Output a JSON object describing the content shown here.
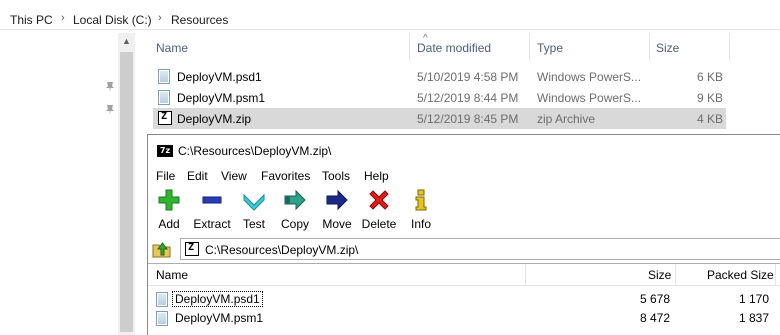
{
  "explorer": {
    "breadcrumb": [
      "This PC",
      "Local Disk (C:)",
      "Resources"
    ],
    "columns": {
      "name": "Name",
      "date": "Date modified",
      "type": "Type",
      "size": "Size"
    },
    "files": [
      {
        "name": "DeployVM.psd1",
        "date": "5/10/2019 4:58 PM",
        "type": "Windows PowerS...",
        "size": "6 KB",
        "icon": "document-icon"
      },
      {
        "name": "DeployVM.psm1",
        "date": "5/12/2019 8:44 PM",
        "type": "Windows PowerS...",
        "size": "9 KB",
        "icon": "document-icon"
      },
      {
        "name": "DeployVM.zip",
        "date": "5/12/2019 8:45 PM",
        "type": "zip Archive",
        "size": "4 KB",
        "icon": "7zip-archive-icon",
        "selected": true
      }
    ]
  },
  "sevenzip": {
    "title": "C:\\Resources\\DeployVM.zip\\",
    "logo": "7z",
    "menu": [
      "File",
      "Edit",
      "View",
      "Favorites",
      "Tools",
      "Help"
    ],
    "toolbar": {
      "add": "Add",
      "extract": "Extract",
      "test": "Test",
      "copy": "Copy",
      "move": "Move",
      "delete": "Delete",
      "info": "Info"
    },
    "path": "C:\\Resources\\DeployVM.zip\\",
    "columns": {
      "name": "Name",
      "size": "Size",
      "packed": "Packed Size"
    },
    "rows": [
      {
        "name": "DeployVM.psd1",
        "size": "5 678",
        "packed": "1 170"
      },
      {
        "name": "DeployVM.psm1",
        "size": "8 472",
        "packed": "1 837"
      }
    ]
  }
}
